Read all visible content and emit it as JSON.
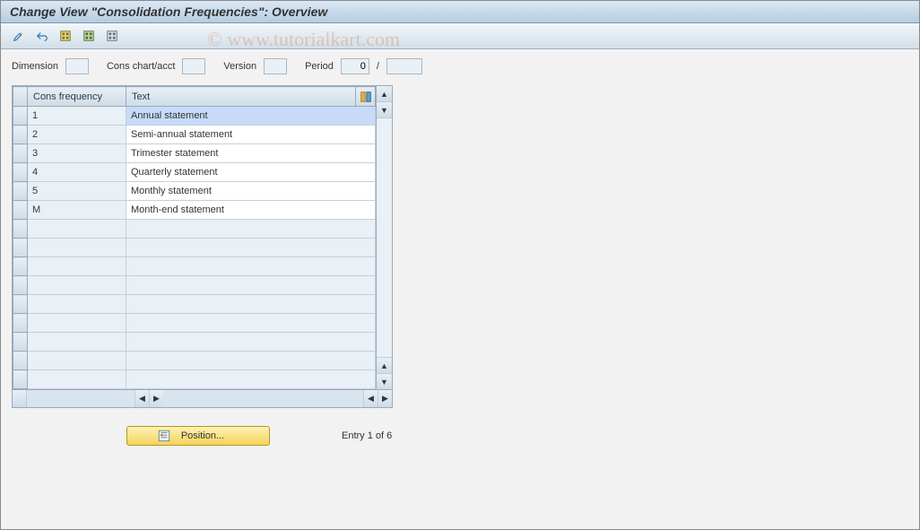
{
  "title": "Change View \"Consolidation Frequencies\": Overview",
  "watermark": "© www.tutorialkart.com",
  "filters": {
    "dimension_label": "Dimension",
    "dimension_value": "",
    "cons_chart_label": "Cons chart/acct",
    "cons_chart_value": "",
    "version_label": "Version",
    "version_value": "",
    "period_label": "Period",
    "period_value1": "0",
    "period_sep": "/",
    "period_value2": ""
  },
  "grid": {
    "col_freq": "Cons frequency",
    "col_text": "Text",
    "rows": [
      {
        "freq": "1",
        "text": "Annual statement"
      },
      {
        "freq": "2",
        "text": "Semi-annual statement"
      },
      {
        "freq": "3",
        "text": "Trimester statement"
      },
      {
        "freq": "4",
        "text": "Quarterly statement"
      },
      {
        "freq": "5",
        "text": "Monthly statement"
      },
      {
        "freq": "M",
        "text": "Month-end statement"
      }
    ],
    "empty_rows": 9
  },
  "footer": {
    "position_label": "Position...",
    "entry_text": "Entry 1 of 6"
  }
}
